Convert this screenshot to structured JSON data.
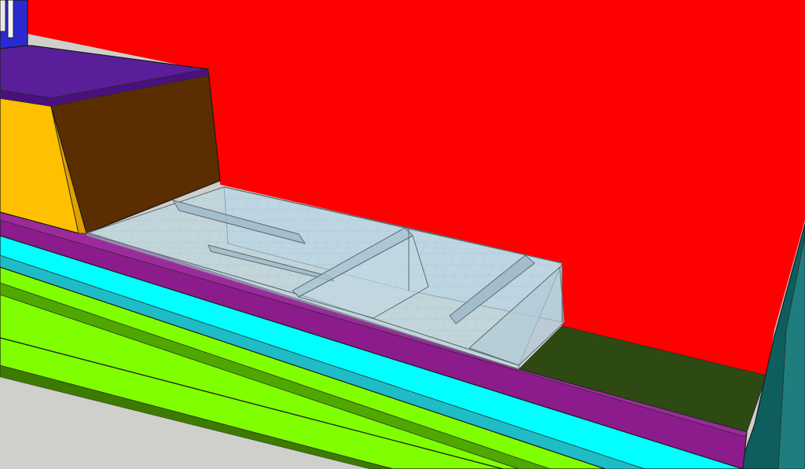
{
  "viewport": {
    "background_color": "#cfd0cc"
  },
  "model": {
    "back_wall_color": "#ff0000",
    "floor_color": "#2d4a12",
    "purple_ledge_color": "#8c1c8c",
    "cyan_strip_color": "#00ffff",
    "lime_strip_color": "#80ff00",
    "teal_post_color": "#0f5e5e",
    "cabinet_top_color": "#5a1e9a",
    "cabinet_front_color": "#ffc000",
    "cabinet_side_color": "#5a2e00",
    "blue_block_color": "#2a2ad0",
    "glass_color": "#b8d8e8"
  }
}
